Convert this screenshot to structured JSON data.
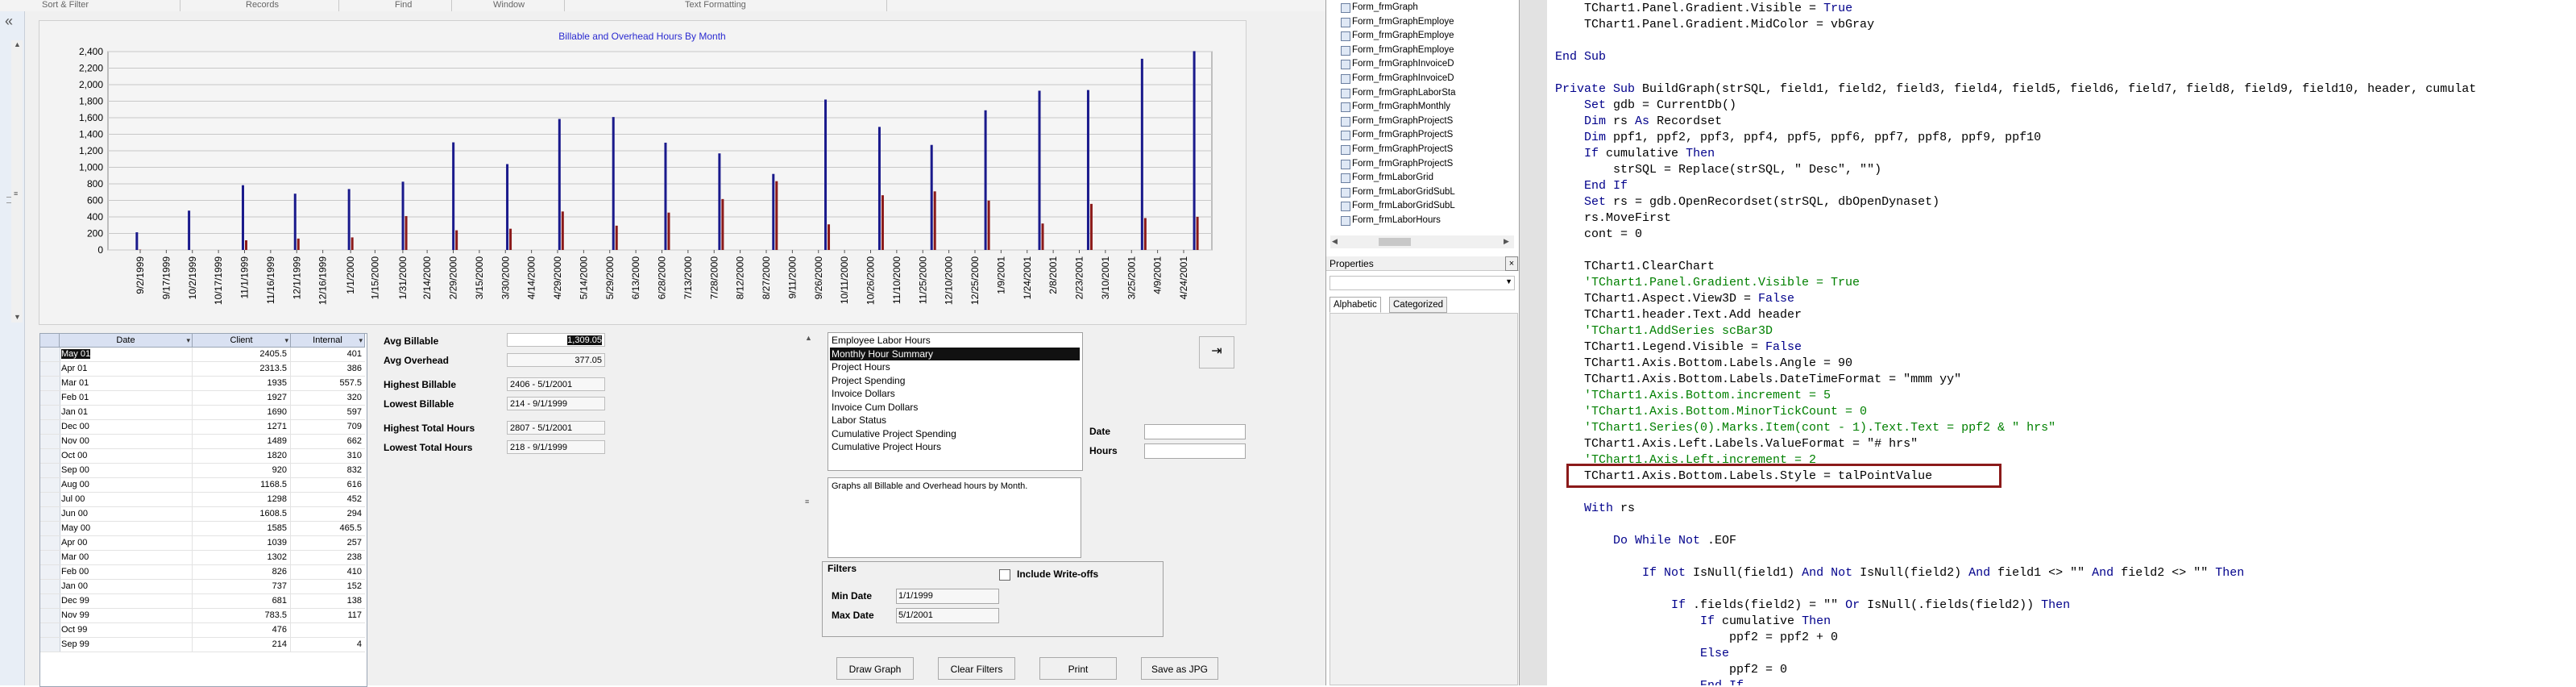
{
  "ribbon": {
    "groups": [
      "Sort & Filter",
      "Records",
      "Find",
      "Window",
      "Text Formatting"
    ]
  },
  "nav_pane": {
    "chevron": "«"
  },
  "chart": {
    "title": "Billable and Overhead Hours By Month",
    "chart_data": {
      "type": "bar",
      "title": "Billable and Overhead Hours By Month",
      "categories": [
        "9/2/1999",
        "9/17/1999",
        "10/2/1999",
        "10/17/1999",
        "11/1/1999",
        "11/16/1999",
        "12/1/1999",
        "12/16/1999",
        "1/1/2000",
        "1/15/2000",
        "1/31/2000",
        "2/14/2000",
        "2/29/2000",
        "3/15/2000",
        "3/30/2000",
        "4/14/2000",
        "4/29/2000",
        "5/14/2000",
        "5/29/2000",
        "6/13/2000",
        "6/28/2000",
        "7/13/2000",
        "7/28/2000",
        "8/12/2000",
        "8/27/2000",
        "9/11/2000",
        "9/26/2000",
        "10/11/2000",
        "10/26/2000",
        "11/10/2000",
        "11/25/2000",
        "12/10/2000",
        "12/25/2000",
        "1/9/2001",
        "1/24/2001",
        "2/8/2001",
        "2/23/2001",
        "3/10/2001",
        "3/25/2001",
        "4/9/2001",
        "4/24/2001"
      ],
      "series": [
        {
          "color": "#1a1a8c",
          "x": [
            "9/1/1999",
            "10/1/1999",
            "11/1/1999",
            "12/1/1999",
            "1/1/2000",
            "2/1/2000",
            "3/1/2000",
            "4/1/2000",
            "5/1/2000",
            "6/1/2000",
            "7/1/2000",
            "8/1/2000",
            "9/1/2000",
            "10/1/2000",
            "11/1/2000",
            "12/1/2000",
            "1/1/2001",
            "2/1/2001",
            "3/1/2001",
            "4/1/2001",
            "5/1/2001"
          ],
          "values": [
            214,
            476,
            783.5,
            681,
            737,
            826,
            1302,
            1039,
            1585,
            1608.5,
            1298,
            1168.5,
            920,
            1820,
            1489,
            1271,
            1690,
            1927,
            1935,
            2313.5,
            2405.5
          ]
        },
        {
          "color": "#8b1a1a",
          "x": [
            "9/1/1999",
            "10/1/1999",
            "11/1/1999",
            "12/1/1999",
            "1/1/2000",
            "2/1/2000",
            "3/1/2000",
            "4/1/2000",
            "5/1/2000",
            "6/1/2000",
            "7/1/2000",
            "8/1/2000",
            "9/1/2000",
            "10/1/2000",
            "11/1/2000",
            "12/1/2000",
            "1/1/2001",
            "2/1/2001",
            "3/1/2001",
            "4/1/2001",
            "5/1/2001"
          ],
          "values": [
            4,
            0,
            117,
            138,
            152,
            410,
            238,
            257,
            465.5,
            294,
            452,
            616,
            832,
            310,
            662,
            709,
            597,
            320,
            557.5,
            386,
            401
          ]
        }
      ],
      "y_ticks": [
        "2,400",
        "2,200",
        "2,000",
        "1,800",
        "1,600",
        "1,400",
        "1,200",
        "1,000",
        "800",
        "600",
        "400",
        "200",
        "0"
      ],
      "ylim": [
        0,
        2400
      ],
      "grid": true,
      "legend": "none"
    }
  },
  "grid": {
    "headers": {
      "date": "Date",
      "client": "Client",
      "internal": "Internal"
    },
    "rows": [
      {
        "date": "May 01",
        "client": "2405.5",
        "internal": "401"
      },
      {
        "date": "Apr 01",
        "client": "2313.5",
        "internal": "386"
      },
      {
        "date": "Mar 01",
        "client": "1935",
        "internal": "557.5"
      },
      {
        "date": "Feb 01",
        "client": "1927",
        "internal": "320"
      },
      {
        "date": "Jan 01",
        "client": "1690",
        "internal": "597"
      },
      {
        "date": "Dec 00",
        "client": "1271",
        "internal": "709"
      },
      {
        "date": "Nov 00",
        "client": "1489",
        "internal": "662"
      },
      {
        "date": "Oct 00",
        "client": "1820",
        "internal": "310"
      },
      {
        "date": "Sep 00",
        "client": "920",
        "internal": "832"
      },
      {
        "date": "Aug 00",
        "client": "1168.5",
        "internal": "616"
      },
      {
        "date": "Jul 00",
        "client": "1298",
        "internal": "452"
      },
      {
        "date": "Jun 00",
        "client": "1608.5",
        "internal": "294"
      },
      {
        "date": "May 00",
        "client": "1585",
        "internal": "465.5"
      },
      {
        "date": "Apr 00",
        "client": "1039",
        "internal": "257"
      },
      {
        "date": "Mar 00",
        "client": "1302",
        "internal": "238"
      },
      {
        "date": "Feb 00",
        "client": "826",
        "internal": "410"
      },
      {
        "date": "Jan 00",
        "client": "737",
        "internal": "152"
      },
      {
        "date": "Dec 99",
        "client": "681",
        "internal": "138"
      },
      {
        "date": "Nov 99",
        "client": "783.5",
        "internal": "117"
      },
      {
        "date": "Oct 99",
        "client": "476",
        "internal": ""
      },
      {
        "date": "Sep 99",
        "client": "214",
        "internal": "4"
      }
    ]
  },
  "stats": {
    "avg_billable_label": "Avg Billable",
    "avg_billable_value": "1,309.05",
    "avg_overhead_label": "Avg Overhead",
    "avg_overhead_value": "377.05",
    "highest_billable_label": "Highest  Billable",
    "highest_billable_value": "2406 - 5/1/2001",
    "lowest_billable_label": "Lowest Billable",
    "lowest_billable_value": "214 - 9/1/1999",
    "highest_total_label": "Highest Total  Hours",
    "highest_total_value": "2807 - 5/1/2001",
    "lowest_total_label": "Lowest Total Hours",
    "lowest_total_value": "218 - 9/1/1999"
  },
  "report_list": {
    "items": [
      "Employee Labor Hours",
      "Monthly Hour Summary",
      "Project Hours",
      "Project Spending",
      "Invoice Dollars",
      "Invoice Cum Dollars",
      "Labor Status",
      "Cumulative Project Spending",
      "Cumulative Project Hours"
    ],
    "selected_index": 1,
    "description": "Graphs all Billable and Overhead hours by Month."
  },
  "side_fields": {
    "date_label": "Date",
    "hours_label": "Hours"
  },
  "filters": {
    "title": "Filters",
    "include_writeoffs_label": "Include Write-offs",
    "min_date_label": "Min Date",
    "min_date_value": "1/1/1999",
    "max_date_label": "Max Date",
    "max_date_value": "5/1/2001"
  },
  "buttons": {
    "draw_graph": "Draw Graph",
    "clear_filters": "Clear Filters",
    "print": "Print",
    "save_jpg": "Save as JPG"
  },
  "explorer": {
    "items": [
      "Form_frmGraph",
      "Form_frmGraphEmploye",
      "Form_frmGraphEmploye",
      "Form_frmGraphEmploye",
      "Form_frmGraphInvoiceD",
      "Form_frmGraphInvoiceD",
      "Form_frmGraphLaborSta",
      "Form_frmGraphMonthly",
      "Form_frmGraphProjectS",
      "Form_frmGraphProjectS",
      "Form_frmGraphProjectS",
      "Form_frmGraphProjectS",
      "Form_frmLaborGrid",
      "Form_frmLaborGridSubL",
      "Form_frmLaborGridSubL",
      "Form_frmLaborHours"
    ]
  },
  "properties": {
    "title": "Properties",
    "close": "×",
    "tab_alphabetic": "Alphabetic",
    "tab_categorized": "Categorized"
  },
  "code": {
    "lines": [
      [
        {
          "t": "    TChart1.Panel.Gradient.Visible = ",
          "c": ""
        },
        {
          "t": "True",
          "c": "kw"
        }
      ],
      [
        {
          "t": "    TChart1.Panel.Gradient.MidColor = vbGray",
          "c": ""
        }
      ],
      [
        {
          "t": "",
          "c": ""
        }
      ],
      [
        {
          "t": "End Sub",
          "c": "kw"
        }
      ],
      [
        {
          "t": "",
          "c": ""
        }
      ],
      [
        {
          "t": "Private Sub ",
          "c": "kw"
        },
        {
          "t": "BuildGraph(strSQL, field1, field2, field3, field4, field5, field6, field7, field8, field9, field10, header, cumulat",
          "c": ""
        }
      ],
      [
        {
          "t": "    ",
          "c": ""
        },
        {
          "t": "Set",
          "c": "kw"
        },
        {
          "t": " gdb = CurrentDb()",
          "c": ""
        }
      ],
      [
        {
          "t": "    ",
          "c": ""
        },
        {
          "t": "Dim",
          "c": "kw"
        },
        {
          "t": " rs ",
          "c": ""
        },
        {
          "t": "As",
          "c": "kw"
        },
        {
          "t": " Recordset",
          "c": ""
        }
      ],
      [
        {
          "t": "    ",
          "c": ""
        },
        {
          "t": "Dim",
          "c": "kw"
        },
        {
          "t": " ppf1, ppf2, ppf3, ppf4, ppf5, ppf6, ppf7, ppf8, ppf9, ppf10",
          "c": ""
        }
      ],
      [
        {
          "t": "    ",
          "c": ""
        },
        {
          "t": "If",
          "c": "kw"
        },
        {
          "t": " cumulative ",
          "c": ""
        },
        {
          "t": "Then",
          "c": "kw"
        }
      ],
      [
        {
          "t": "        strSQL = Replace(strSQL, \" Desc\", \"\")",
          "c": ""
        }
      ],
      [
        {
          "t": "    ",
          "c": ""
        },
        {
          "t": "End If",
          "c": "kw"
        }
      ],
      [
        {
          "t": "    ",
          "c": ""
        },
        {
          "t": "Set",
          "c": "kw"
        },
        {
          "t": " rs = gdb.OpenRecordset(strSQL, dbOpenDynaset)",
          "c": ""
        }
      ],
      [
        {
          "t": "    rs.MoveFirst",
          "c": ""
        }
      ],
      [
        {
          "t": "    cont = 0",
          "c": ""
        }
      ],
      [
        {
          "t": "",
          "c": ""
        }
      ],
      [
        {
          "t": "    TChart1.ClearChart",
          "c": ""
        }
      ],
      [
        {
          "t": "    'TChart1.Panel.Gradient.Visible = True",
          "c": "cm"
        }
      ],
      [
        {
          "t": "    TChart1.Aspect.View3D = ",
          "c": ""
        },
        {
          "t": "False",
          "c": "kw"
        }
      ],
      [
        {
          "t": "    TChart1.header.Text.Add header",
          "c": ""
        }
      ],
      [
        {
          "t": "    'TChart1.AddSeries scBar3D",
          "c": "cm"
        }
      ],
      [
        {
          "t": "    TChart1.Legend.Visible = ",
          "c": ""
        },
        {
          "t": "False",
          "c": "kw"
        }
      ],
      [
        {
          "t": "    TChart1.Axis.Bottom.Labels.Angle = 90",
          "c": ""
        }
      ],
      [
        {
          "t": "    TChart1.Axis.Bottom.Labels.DateTimeFormat = \"mmm yy\"",
          "c": ""
        }
      ],
      [
        {
          "t": "    'TChart1.Axis.Bottom.increment = 5",
          "c": "cm"
        }
      ],
      [
        {
          "t": "    'TChart1.Axis.Bottom.MinorTickCount = 0",
          "c": "cm"
        }
      ],
      [
        {
          "t": "    'TChart1.Series(0).Marks.Item(cont - 1).Text.Text = ppf2 & \" hrs\"",
          "c": "cm"
        }
      ],
      [
        {
          "t": "    TChart1.Axis.Left.Labels.ValueFormat = \"# hrs\"",
          "c": ""
        }
      ],
      [
        {
          "t": "    'TChart1.Axis.Left.increment = 2",
          "c": "cm"
        }
      ],
      [
        {
          "t": "    TChart1.Axis.Bottom.Labels.Style = talPointValue",
          "c": ""
        }
      ],
      [
        {
          "t": "",
          "c": ""
        }
      ],
      [
        {
          "t": "    ",
          "c": ""
        },
        {
          "t": "With",
          "c": "kw"
        },
        {
          "t": " rs",
          "c": ""
        }
      ],
      [
        {
          "t": "",
          "c": ""
        }
      ],
      [
        {
          "t": "        ",
          "c": ""
        },
        {
          "t": "Do While Not",
          "c": "kw"
        },
        {
          "t": " .EOF",
          "c": ""
        }
      ],
      [
        {
          "t": "",
          "c": ""
        }
      ],
      [
        {
          "t": "            ",
          "c": ""
        },
        {
          "t": "If Not",
          "c": "kw"
        },
        {
          "t": " IsNull(field1) ",
          "c": ""
        },
        {
          "t": "And Not",
          "c": "kw"
        },
        {
          "t": " IsNull(field2) ",
          "c": ""
        },
        {
          "t": "And",
          "c": "kw"
        },
        {
          "t": " field1 <> \"\" ",
          "c": ""
        },
        {
          "t": "And",
          "c": "kw"
        },
        {
          "t": " field2 <> \"\" ",
          "c": ""
        },
        {
          "t": "Then",
          "c": "kw"
        }
      ],
      [
        {
          "t": "",
          "c": ""
        }
      ],
      [
        {
          "t": "                ",
          "c": ""
        },
        {
          "t": "If",
          "c": "kw"
        },
        {
          "t": " .fields(field2) = \"\" ",
          "c": ""
        },
        {
          "t": "Or",
          "c": "kw"
        },
        {
          "t": " IsNull(.fields(field2)) ",
          "c": ""
        },
        {
          "t": "Then",
          "c": "kw"
        }
      ],
      [
        {
          "t": "                    ",
          "c": ""
        },
        {
          "t": "If",
          "c": "kw"
        },
        {
          "t": " cumulative ",
          "c": ""
        },
        {
          "t": "Then",
          "c": "kw"
        }
      ],
      [
        {
          "t": "                        ppf2 = ppf2 + 0",
          "c": ""
        }
      ],
      [
        {
          "t": "                    ",
          "c": ""
        },
        {
          "t": "Else",
          "c": "kw"
        }
      ],
      [
        {
          "t": "                        ppf2 = 0",
          "c": ""
        }
      ],
      [
        {
          "t": "                    ",
          "c": ""
        },
        {
          "t": "End If",
          "c": "kw"
        }
      ]
    ]
  }
}
